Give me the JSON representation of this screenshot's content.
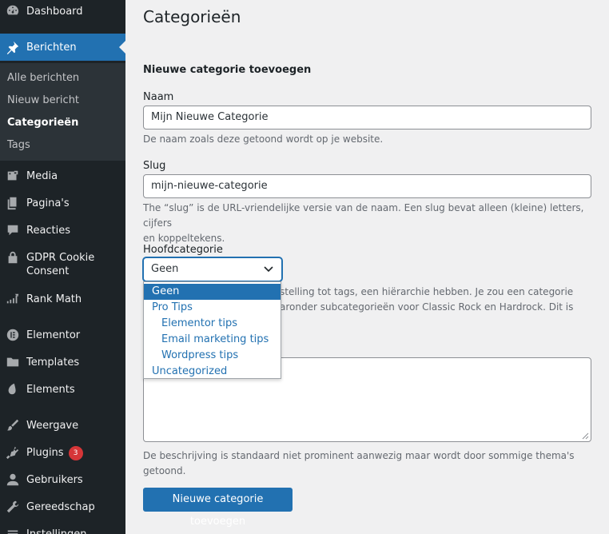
{
  "sidebar": {
    "items": [
      {
        "label": "Dashboard",
        "icon": "dashboard-icon"
      },
      {
        "label": "Berichten",
        "icon": "pin-icon"
      },
      {
        "label": "Media",
        "icon": "media-icon"
      },
      {
        "label": "Pagina's",
        "icon": "pages-icon"
      },
      {
        "label": "Reacties",
        "icon": "comments-icon"
      },
      {
        "label": "GDPR Cookie Consent",
        "icon": "lock-icon"
      },
      {
        "label": "Rank Math",
        "icon": "rank-math-icon"
      },
      {
        "label": "Elementor",
        "icon": "elementor-icon"
      },
      {
        "label": "Templates",
        "icon": "folder-icon"
      },
      {
        "label": "Elements",
        "icon": "elements-icon"
      },
      {
        "label": "Weergave",
        "icon": "brush-icon"
      },
      {
        "label": "Plugins",
        "icon": "plugin-icon",
        "badge": "3"
      },
      {
        "label": "Gebruikers",
        "icon": "users-icon"
      },
      {
        "label": "Gereedschap",
        "icon": "wrench-icon"
      },
      {
        "label": "Instellingen",
        "icon": "settings-icon"
      }
    ],
    "submenu": [
      "Alle berichten",
      "Nieuw bericht",
      "Categorieën",
      "Tags"
    ]
  },
  "page": {
    "title": "Categorieën"
  },
  "form": {
    "section_title": "Nieuwe categorie toevoegen",
    "name_label": "Naam",
    "name_value": "Mijn Nieuwe Categorie",
    "name_help": "De naam zoals deze getoond wordt op je website.",
    "slug_label": "Slug",
    "slug_value": "mijn-nieuwe-categorie",
    "slug_help_1": "The “slug” is de URL-vriendelijke versie van de naam. Een slug bevat alleen (kleine) letters, cijfers",
    "slug_help_2": "en koppeltekens.",
    "parent_label": "Hoofdcategorie",
    "parent_selected": "Geen",
    "parent_options": [
      "Geen",
      "Pro Tips",
      "Elementor tips",
      "Email marketing tips",
      "Wordpress tips",
      "Uncategorized"
    ],
    "parent_help_1": "stelling tot tags, een hiërarchie hebben. Je zou een categorie",
    "parent_help_2": "aronder subcategorieën voor Classic Rock en Hardrock. Dit is",
    "desc_help_1": "De beschrijving is standaard niet prominent aanwezig maar wordt door sommige thema's",
    "desc_help_2": "getoond.",
    "submit_label": "Nieuwe categorie toevoegen"
  },
  "colors": {
    "accent": "#2271b1",
    "sidebar_bg": "#1d2327",
    "badge": "#d63638"
  }
}
